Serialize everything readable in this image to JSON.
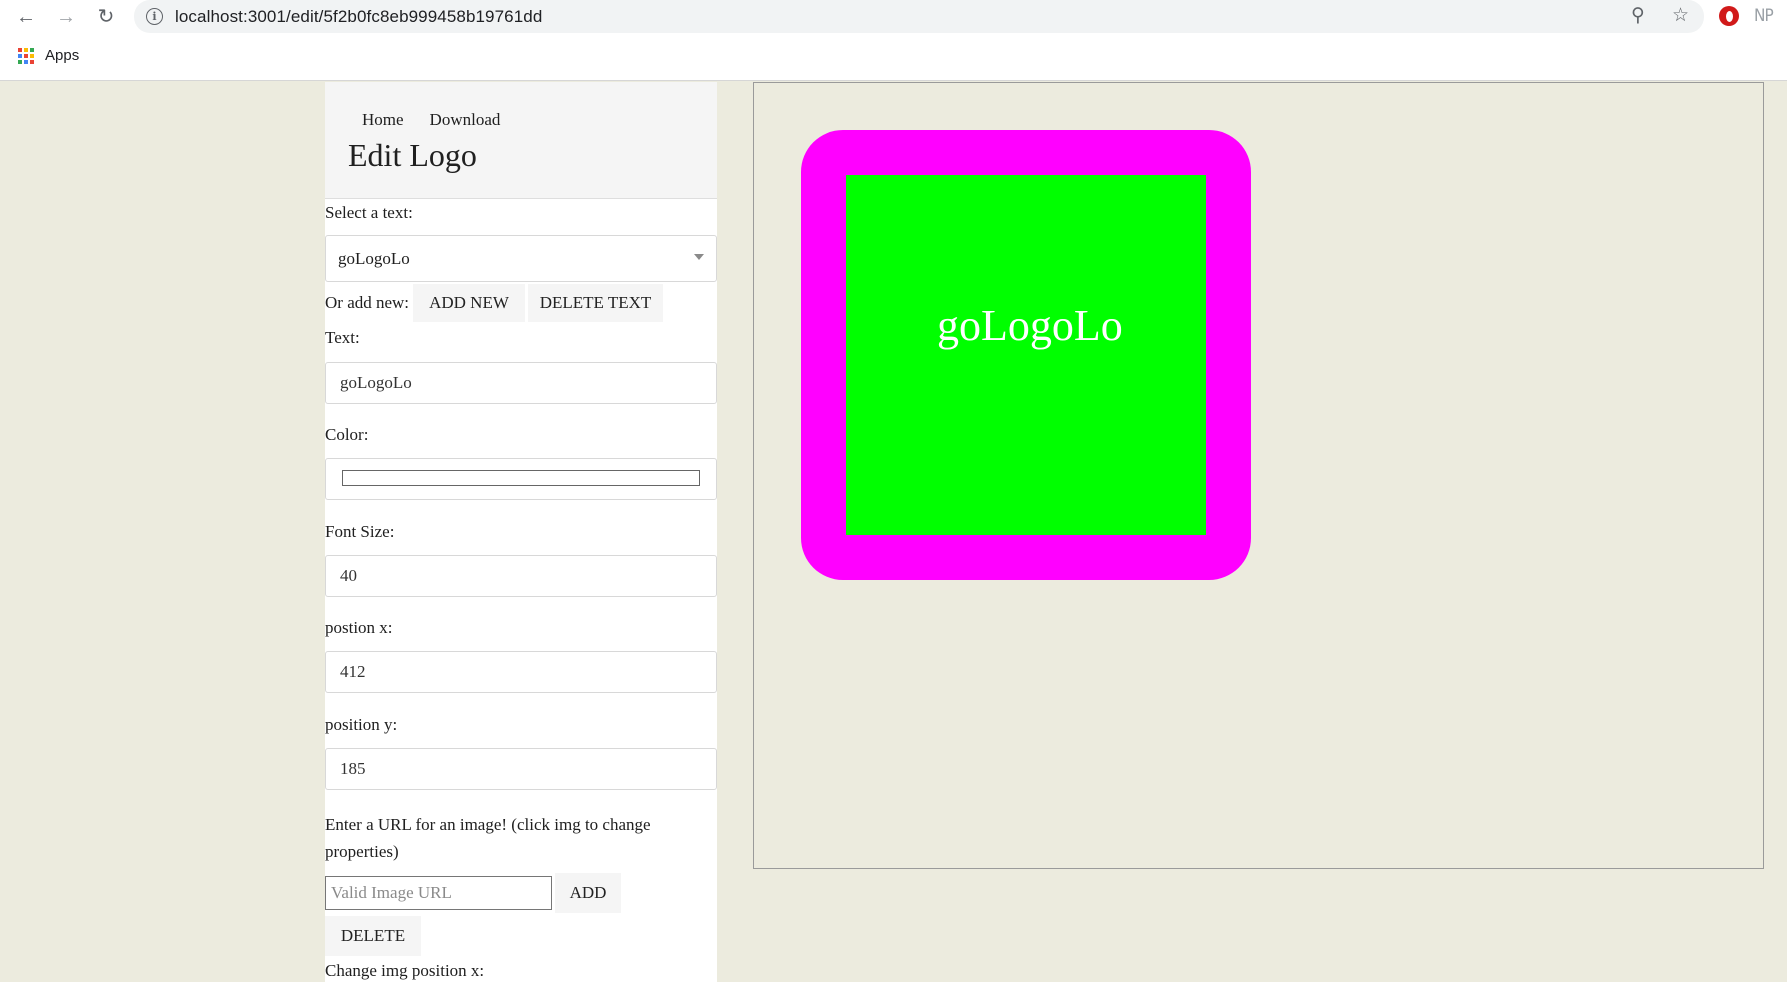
{
  "browser": {
    "url": "localhost:3001/edit/5f2b0fc8eb999458b19761dd",
    "bookmarks_apps_label": "Apps",
    "apps_grid_colors": [
      "#ea4335",
      "#fbbc05",
      "#34a853",
      "#4285f4",
      "#ea4335",
      "#fbbc05",
      "#34a853",
      "#4285f4",
      "#ea4335"
    ],
    "extensions": [
      "opera-icon",
      "NP"
    ]
  },
  "nav": {
    "home": "Home",
    "download": "Download"
  },
  "page_title": "Edit Logo",
  "form": {
    "select_text_label": "Select a text:",
    "selected_text": "goLogoLo",
    "or_add_new_label": "Or add new:",
    "add_new_button": "ADD NEW",
    "delete_text_button": "DELETE TEXT",
    "text_label": "Text:",
    "text_value": "goLogoLo",
    "color_label": "Color:",
    "color_value": "#ffffff",
    "font_size_label": "Font Size:",
    "font_size_value": "40",
    "position_x_label": "postion x:",
    "position_x_value": "412",
    "position_y_label": "position y:",
    "position_y_value": "185",
    "image_url_label": "Enter a URL for an image! (click img to change properties)",
    "image_url_placeholder": "Valid Image URL",
    "add_button": "ADD",
    "delete_button": "DELETE",
    "img_position_x_label": "Change img position x:"
  },
  "logo": {
    "text": "goLogoLo",
    "text_color": "#ffffff",
    "background_color": "#00ff00",
    "border_color": "#ff00ff"
  }
}
